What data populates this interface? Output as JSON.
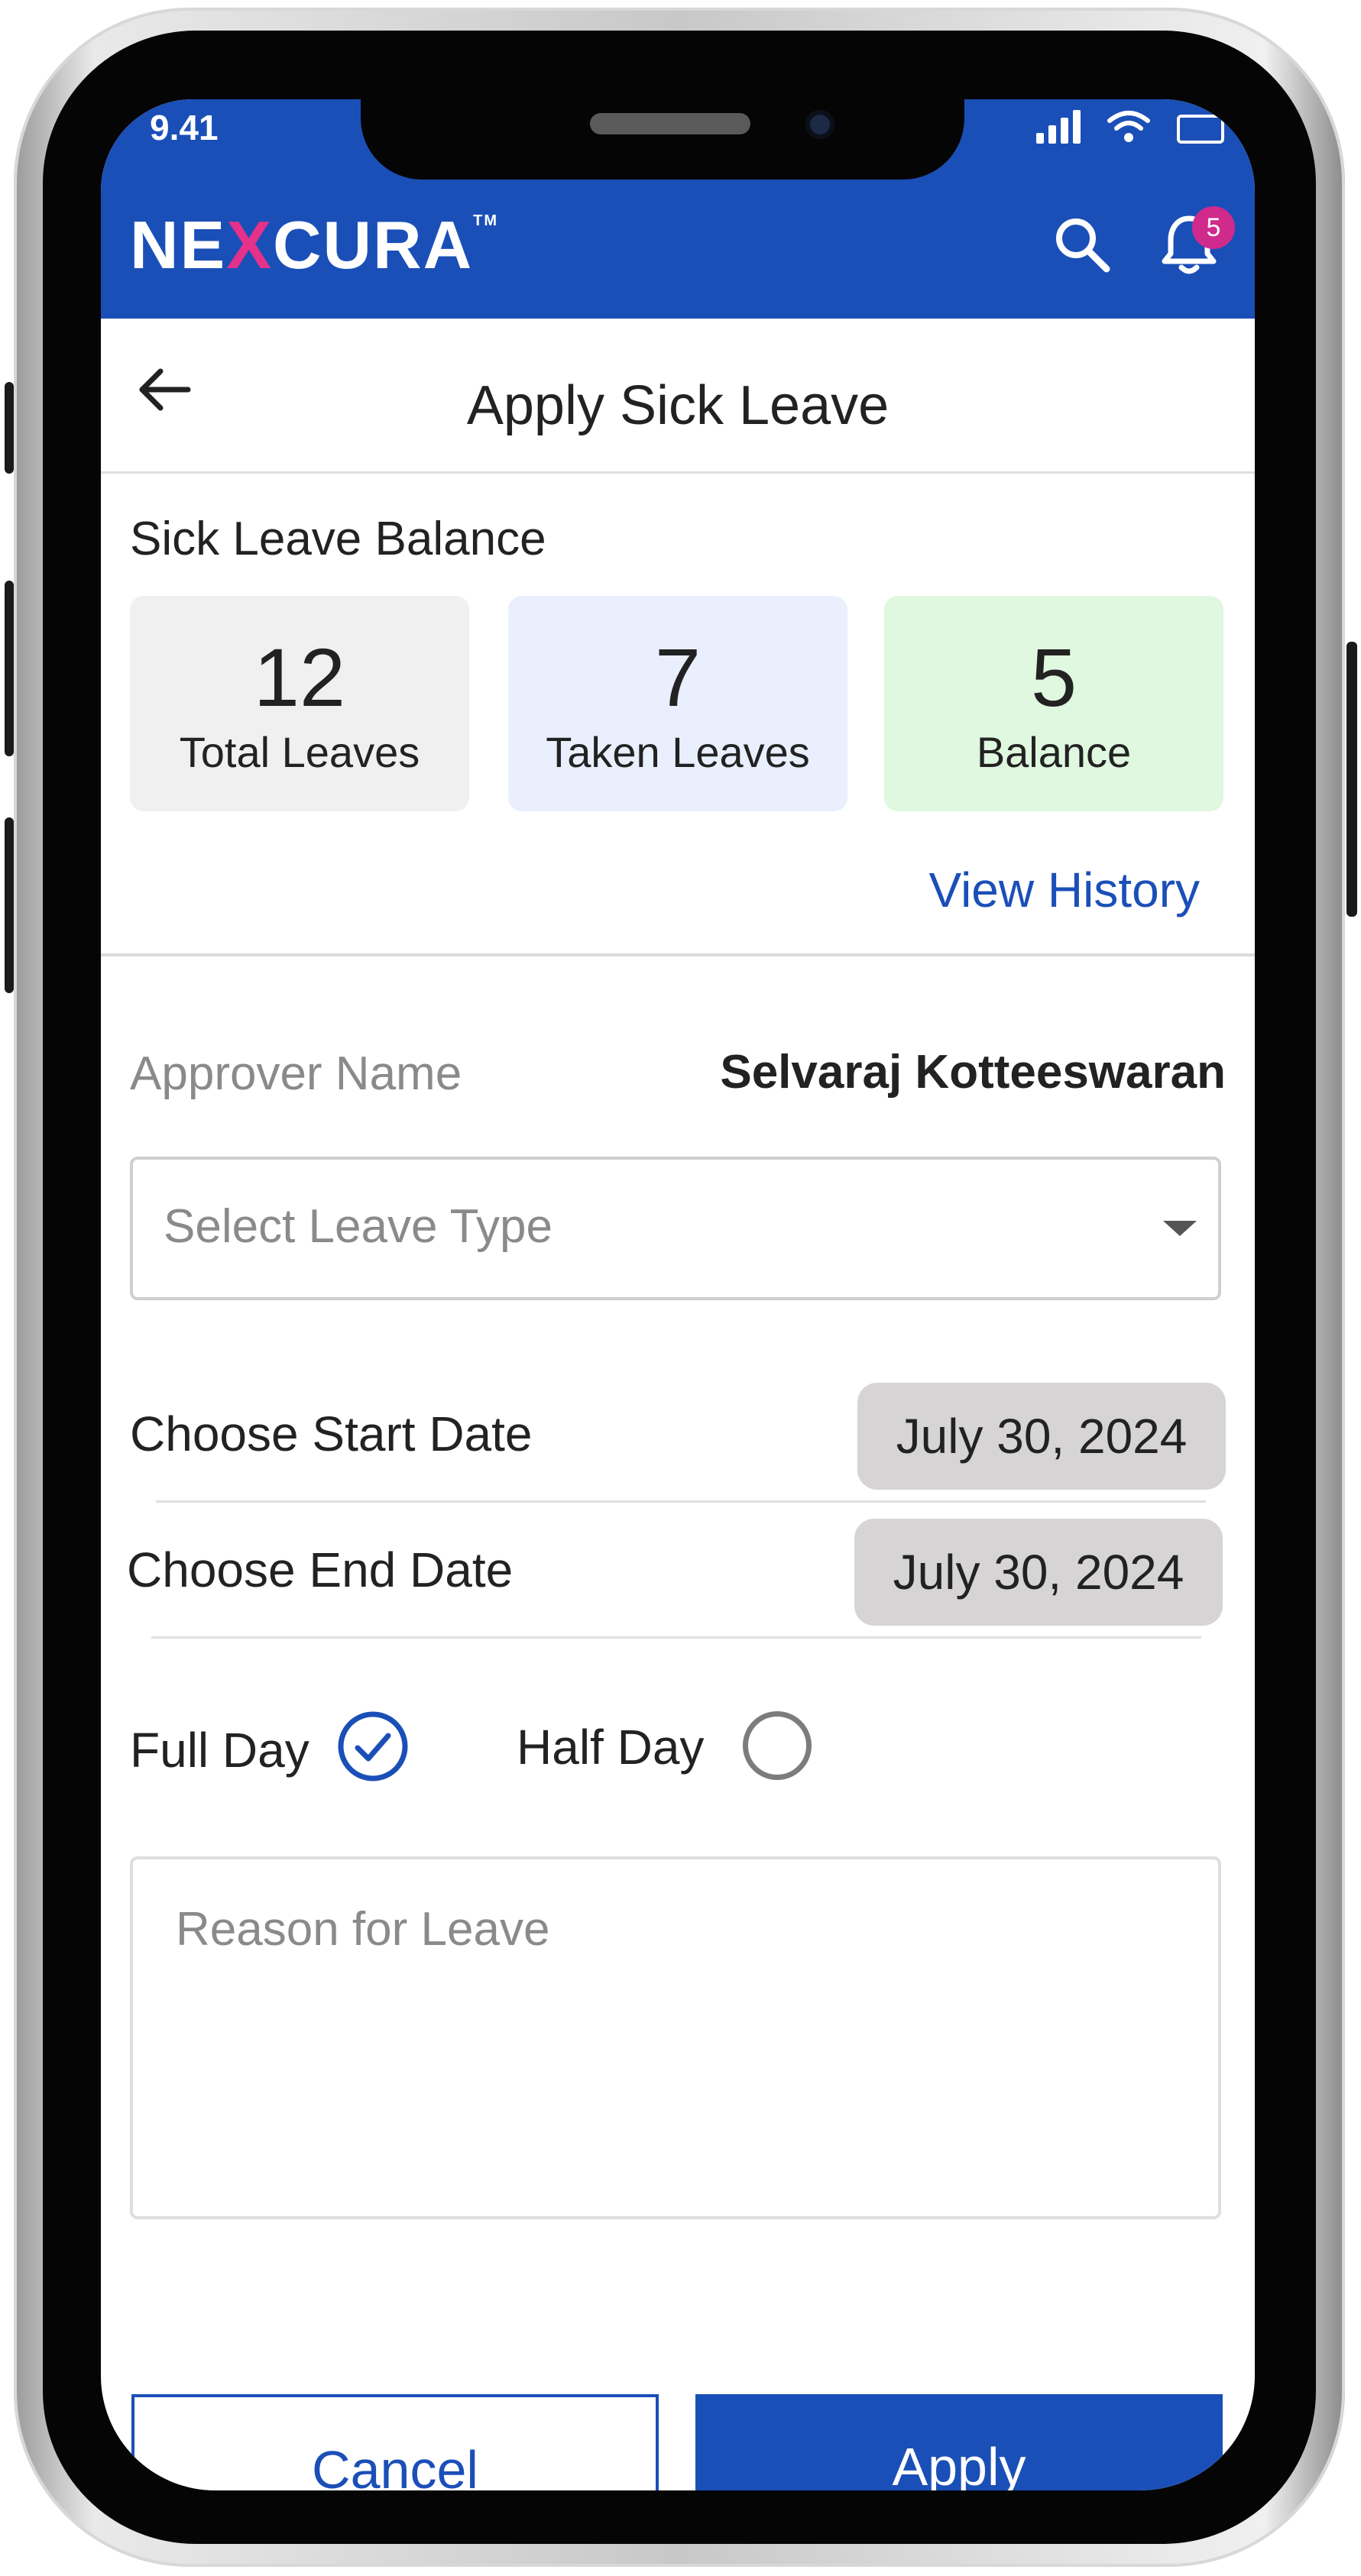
{
  "status_bar": {
    "time": "9.41"
  },
  "app": {
    "logo_prefix": "NE",
    "logo_x": "X",
    "logo_suffix": "CURA",
    "logo_tm": "TM",
    "notification_count": "5"
  },
  "page": {
    "title": "Apply Sick Leave"
  },
  "balance": {
    "section_label": "Sick Leave Balance",
    "cards": [
      {
        "value": "12",
        "label": "Total Leaves"
      },
      {
        "value": "7",
        "label": "Taken Leaves"
      },
      {
        "value": "5",
        "label": "Balance"
      }
    ],
    "view_history": "View History"
  },
  "approver": {
    "label": "Approver Name",
    "name": "Selvaraj Kotteeswaran"
  },
  "leave_type": {
    "placeholder": "Select Leave Type"
  },
  "dates": {
    "start_label": "Choose Start Date",
    "start_value": "July 30, 2024",
    "end_label": "Choose End Date",
    "end_value": "July 30, 2024"
  },
  "day_type": {
    "full_label": "Full Day",
    "half_label": "Half Day",
    "selected": "Full Day"
  },
  "reason": {
    "placeholder": "Reason for Leave"
  },
  "actions": {
    "cancel": "Cancel",
    "apply": "Apply"
  },
  "colors": {
    "primary": "#1b4fb8",
    "badge": "#d02a8c",
    "balance_green": "#dff8df",
    "taken_blue": "#e9effd"
  },
  "icons": [
    "search-icon",
    "bell-icon",
    "back-arrow-icon",
    "caret-down-icon",
    "check-circle-icon"
  ]
}
